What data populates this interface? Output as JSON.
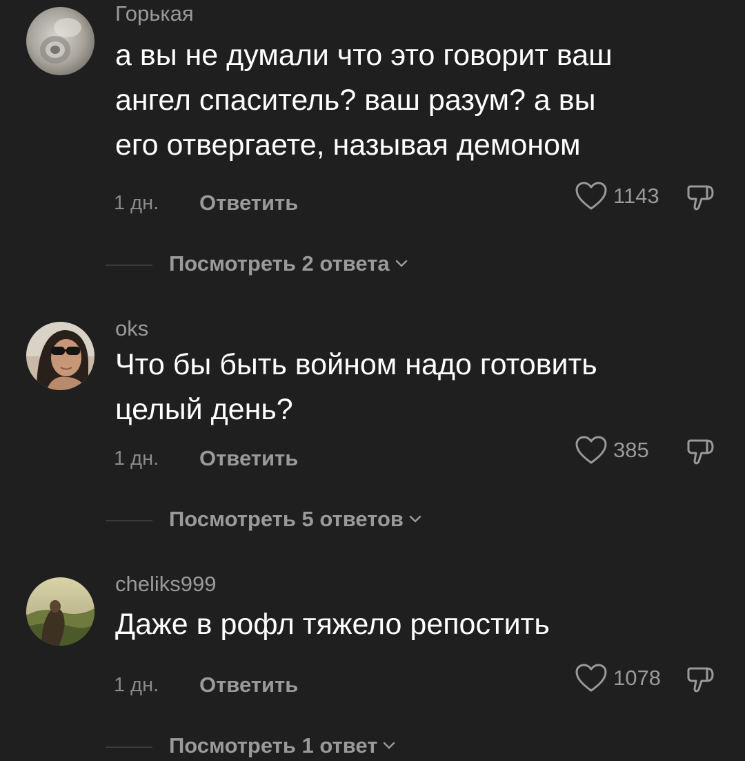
{
  "comments": [
    {
      "username": "Горькая",
      "lines": [
        "а вы не думали что это говорит ваш",
        "ангел спаситель? ваш разум? а вы",
        "его отвергаете, называя демоном"
      ],
      "time": "1 дн.",
      "reply_label": "Ответить",
      "likes": "1143",
      "view_replies": "Посмотреть 2 ответа",
      "avatar_icon": "seashell-avatar"
    },
    {
      "username": "oks",
      "lines": [
        "Что бы быть войном надо готовить",
        "целый день?"
      ],
      "time": "1 дн.",
      "reply_label": "Ответить",
      "likes": "385",
      "view_replies": "Посмотреть 5 ответов",
      "avatar_icon": "woman-sunglasses-avatar"
    },
    {
      "username": "cheliks999",
      "lines": [
        "Даже в рофл тяжело репостить"
      ],
      "time": "1 дн.",
      "reply_label": "Ответить",
      "likes": "1078",
      "view_replies": "Посмотреть 1 ответ",
      "avatar_icon": "landscape-figure-avatar"
    }
  ],
  "icons": {
    "like": "heart-outline-icon",
    "dislike": "thumbs-down-outline-icon",
    "expand": "chevron-down-icon"
  },
  "colors": {
    "background": "#1f1f1f",
    "primary_text": "#ffffff",
    "secondary_text": "#9a9a9a"
  }
}
